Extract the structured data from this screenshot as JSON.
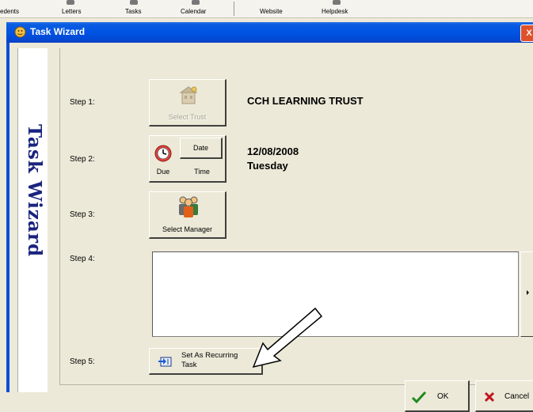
{
  "background_toolbar": {
    "items": [
      "edents",
      "Letters",
      "Tasks",
      "Calendar",
      "Website",
      "Helpdesk"
    ]
  },
  "window": {
    "title": "Task Wizard",
    "close_glyph": "X",
    "side_banner_text": "Task Wizard"
  },
  "steps": {
    "step1": {
      "label": "Step 1:",
      "button_label": "Select Trust",
      "value": "CCH LEARNING TRUST"
    },
    "step2": {
      "label": "Step 2:",
      "due_label": "Due",
      "date_label": "Date",
      "time_label": "Time",
      "date_value": "12/08/2008",
      "day_value": "Tuesday"
    },
    "step3": {
      "label": "Step 3:",
      "button_label": "Select Manager"
    },
    "step4": {
      "label": "Step 4:",
      "notes_value": ""
    },
    "step5": {
      "label": "Step 5:",
      "button_line1": "Set As Recurring",
      "button_line2": "Task"
    }
  },
  "footer": {
    "ok_label": "OK",
    "cancel_label": "Cancel"
  },
  "colors": {
    "titlebar": "#0054e3",
    "dialog_bg": "#ece9d8",
    "banner_text": "#1a237e",
    "ok_check": "#1f8a1f",
    "cancel_x": "#c0141e"
  },
  "icons": [
    "task-wizard-icon",
    "trust-icon",
    "clock-icon",
    "manager-icon",
    "recurring-icon",
    "checkmark-icon",
    "x-icon",
    "arrow-right-icon"
  ]
}
